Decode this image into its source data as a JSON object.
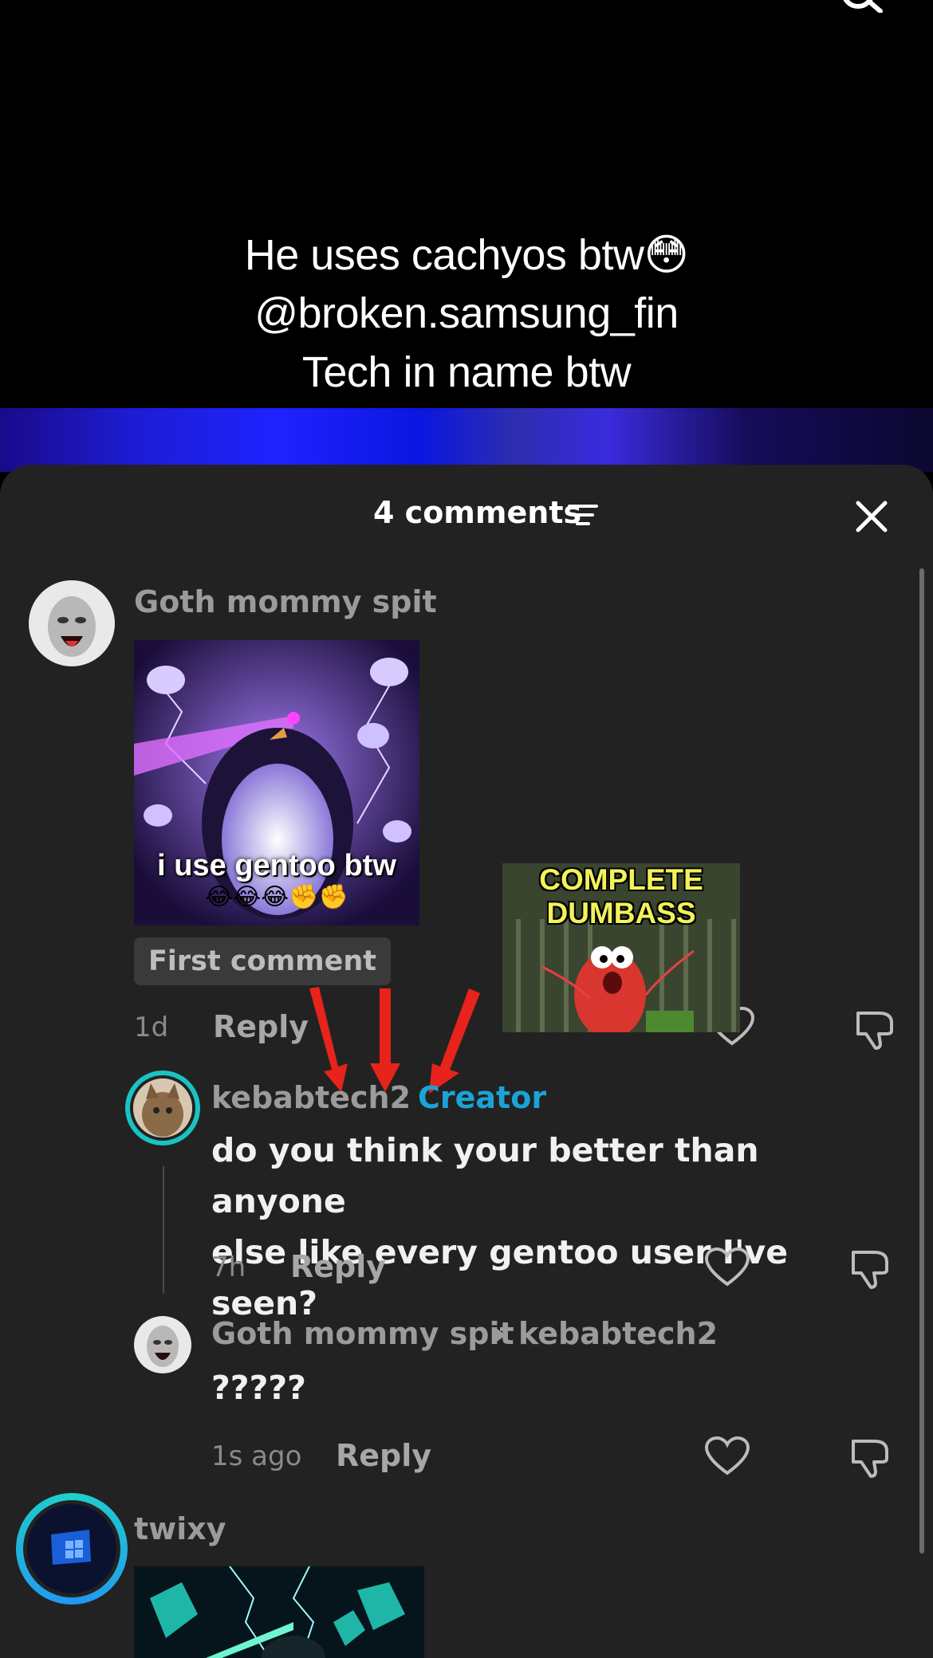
{
  "caption": {
    "line1": "He uses cachyos btw😳",
    "line2": "@broken.samsung_fin",
    "line3": "Tech in name btw"
  },
  "sheet": {
    "title": "4 comments"
  },
  "comments": [
    {
      "author": "Goth mommy spit",
      "image_caption": "i use gentoo btw",
      "image_emojis": "😂😂😂✊✊",
      "badge": "First comment",
      "time": "1d",
      "reply_label": "Reply"
    },
    {
      "author": "kebabtech2",
      "separator": "·",
      "role": "Creator",
      "text_line1": "do you think your better than anyone",
      "text_line2": "else like every gentoo user I've seen?",
      "time": "7h",
      "reply_label": "Reply"
    },
    {
      "author": "Goth mommy spit",
      "reply_to": "kebabtech2",
      "text": "?????",
      "time": "1s ago",
      "reply_label": "Reply"
    },
    {
      "author": "twixy"
    }
  ],
  "overlay_meme": {
    "line1": "COMPLETE",
    "line2": "DUMBASS"
  },
  "colors": {
    "sheet_bg": "#222222",
    "creator": "#1ba3d6",
    "arrow": "#e8231c"
  }
}
